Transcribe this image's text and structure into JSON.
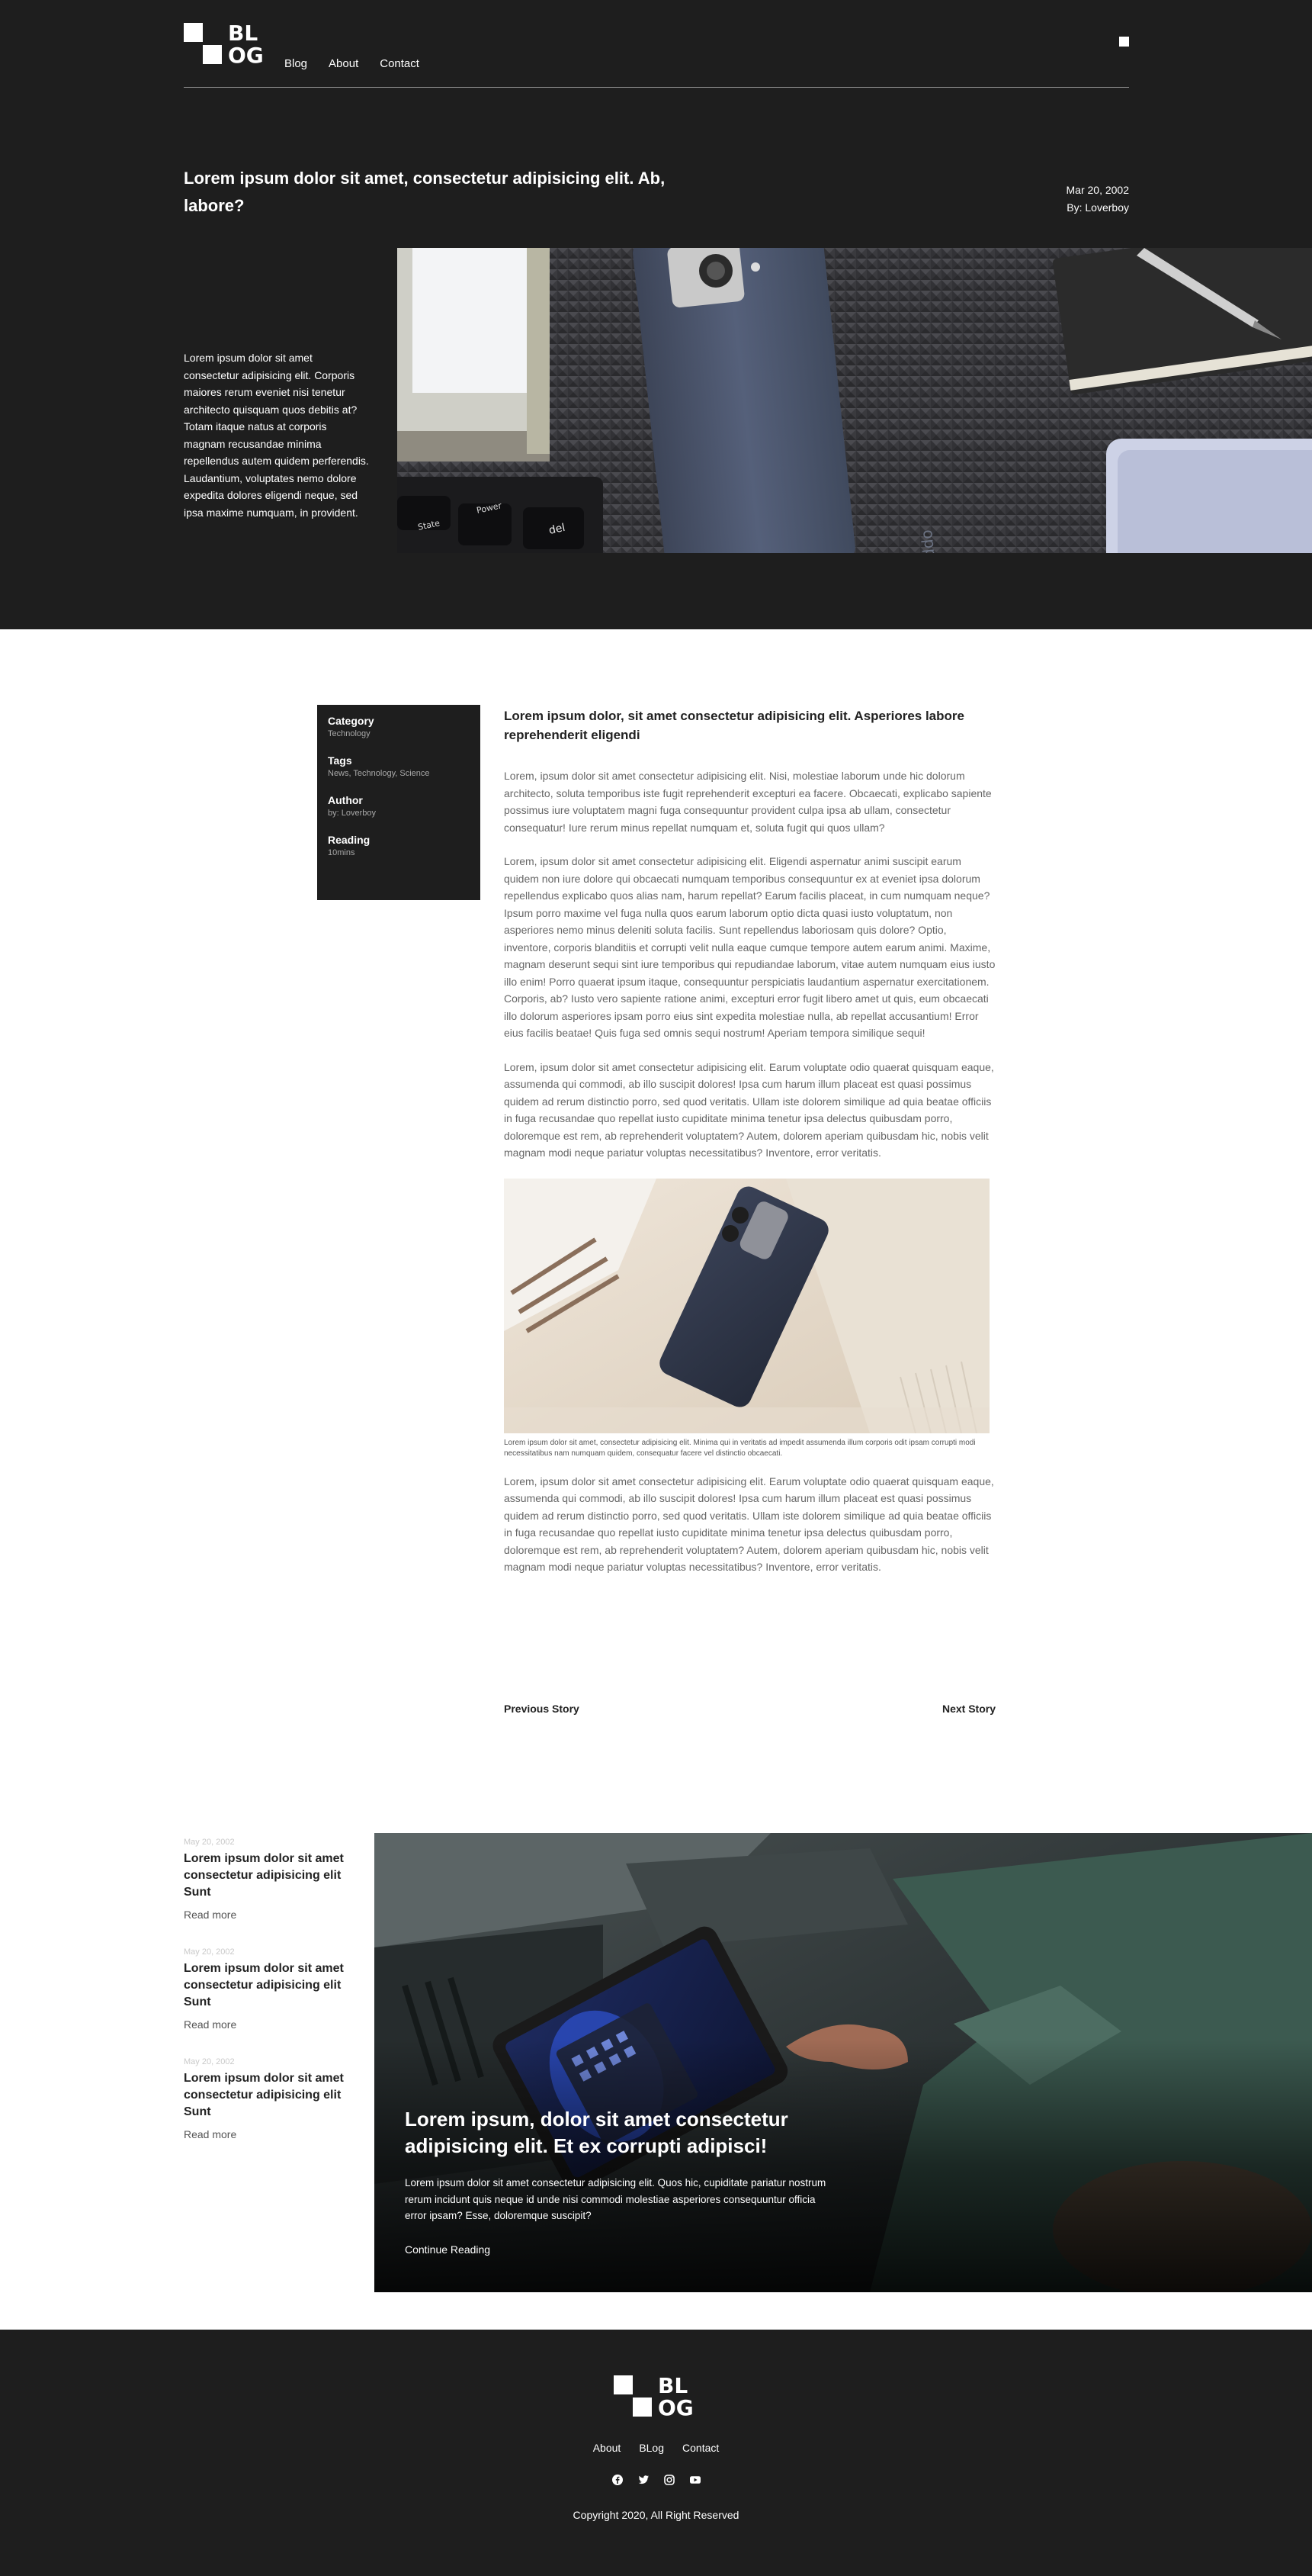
{
  "header": {
    "logo": {
      "line1": "BL",
      "line2": "OG"
    },
    "nav": [
      "Blog",
      "About",
      "Contact"
    ],
    "menu_icon": "square-menu-icon"
  },
  "hero": {
    "title": "Lorem ipsum dolor sit amet, consectetur adipisicing elit. Ab, labore?",
    "date": "Mar 20, 2002",
    "author": "By: Loverboy",
    "excerpt": "Lorem ipsum dolor sit amet consectetur adipisicing elit. Corporis maiores rerum eveniet nisi tenetur architecto quisquam quos debitis at? Totam itaque natus at corporis magnam recusandae minima repellendus autem quidem perferendis. Laudantium, voluptates nemo dolore expedita dolores eligendi neque, sed ipsa maxime numquam, in provident.",
    "image": "desk-flatlay-phone-keyboard-photo",
    "keyboard_keys": [
      "State",
      "Power",
      "del"
    ]
  },
  "sidebar": {
    "items": [
      {
        "label": "Category",
        "value": "Technology"
      },
      {
        "label": "Tags",
        "value": "News, Technology, Science"
      },
      {
        "label": "Author",
        "value": "by: Loverboy"
      },
      {
        "label": "Reading",
        "value": "10mins"
      }
    ]
  },
  "article": {
    "title": "Lorem ipsum dolor, sit amet consectetur adipisicing elit. Asperiores labore reprehenderit eligendi",
    "paragraphs": [
      "Lorem, ipsum dolor sit amet consectetur adipisicing elit. Nisi, molestiae laborum unde hic dolorum architecto, soluta temporibus iste fugit reprehenderit excepturi ea facere. Obcaecati, explicabo sapiente possimus iure voluptatem magni fuga consequuntur provident culpa ipsa ab ullam, consectetur consequatur! Iure rerum minus repellat numquam et, soluta fugit qui quos ullam?",
      "Lorem, ipsum dolor sit amet consectetur adipisicing elit. Eligendi aspernatur animi suscipit earum quidem non iure dolore qui obcaecati numquam temporibus consequuntur ex at eveniet ipsa dolorum repellendus explicabo quos alias nam, harum repellat? Earum facilis placeat, in cum numquam neque? Ipsum porro maxime vel fuga nulla quos earum laborum optio dicta quasi iusto voluptatum, non asperiores nemo minus deleniti soluta facilis. Sunt repellendus laboriosam quis dolore? Optio, inventore, corporis blanditiis et corrupti velit nulla eaque cumque tempore autem earum animi. Maxime, magnam deserunt sequi sint iure temporibus qui repudiandae laborum, vitae autem numquam eius iusto illo enim! Porro quaerat ipsum itaque, consequuntur perspiciatis laudantium aspernatur exercitationem. Corporis, ab? Iusto vero sapiente ratione animi, excepturi error fugit libero amet ut quis, eum obcaecati illo dolorum asperiores ipsam porro eius sint expedita molestiae nulla, ab repellat accusantium! Error eius facilis beatae! Quis fuga sed omnis sequi nostrum! Aperiam tempora similique sequi!",
      "Lorem, ipsum dolor sit amet consectetur adipisicing elit. Earum voluptate odio quaerat quisquam eaque, assumenda qui commodi, ab illo suscipit dolores! Ipsa cum harum illum placeat est quasi possimus quidem ad rerum distinctio porro, sed quod veritatis. Ullam iste dolorem similique ad quia beatae officiis in fuga recusandae quo repellat iusto cupiditate minima tenetur ipsa delectus quibusdam porro, doloremque est rem, ab reprehenderit voluptatem? Autem, dolorem aperiam quibusdam hic, nobis velit magnam modi neque pariatur voluptas necessitatibus? Inventore, error veritatis."
    ],
    "image": "phone-on-blanket-photo",
    "caption": "Lorem ipsum dolor sit amet, consectetur adipisicing elit. Minima qui in veritatis ad impedit assumenda illum corporis odit ipsam corrupti modi necessitatibus nam numquam quidem, consequatur facere vel distinctio obcaecati.",
    "paragraph_after": "Lorem, ipsum dolor sit amet consectetur adipisicing elit. Earum voluptate odio quaerat quisquam eaque, assumenda qui commodi, ab illo suscipit dolores! Ipsa cum harum illum placeat est quasi possimus quidem ad rerum distinctio porro, sed quod veritatis. Ullam iste dolorem similique ad quia beatae officiis in fuga recusandae quo repellat iusto cupiditate minima tenetur ipsa delectus quibusdam porro, doloremque est rem, ab reprehenderit voluptatem? Autem, dolorem aperiam quibusdam hic, nobis velit magnam modi neque pariatur voluptas necessitatibus? Inventore, error veritatis."
  },
  "story_nav": {
    "previous": "Previous Story",
    "next": "Next Story"
  },
  "related": {
    "items": [
      {
        "date": "May 20, 2002",
        "title": "Lorem ipsum dolor sit amet consectetur adipisicing elit Sunt",
        "link": "Read more"
      },
      {
        "date": "May 20, 2002",
        "title": "Lorem ipsum dolor sit amet consectetur adipisicing elit Sunt",
        "link": "Read more"
      },
      {
        "date": "May 20, 2002",
        "title": "Lorem ipsum dolor sit amet consectetur adipisicing elit Sunt",
        "link": "Read more"
      }
    ],
    "feature": {
      "title": "Lorem ipsum, dolor sit amet consectetur adipisicing elit. Et ex corrupti adipisci!",
      "text": "Lorem ipsum dolor sit amet consectetur adipisicing elit. Quos hic, cupiditate pariatur nostrum rerum incidunt quis neque id unde nisi commodi molestiae asperiores consequuntur officia error ipsam? Esse, doloremque suscipit?",
      "link": "Continue Reading",
      "image": "man-holding-tablet-in-car-photo"
    }
  },
  "footer": {
    "logo": {
      "line1": "BL",
      "line2": "OG"
    },
    "nav": [
      "About",
      "BLog",
      "Contact"
    ],
    "socials": [
      "facebook-icon",
      "twitter-icon",
      "instagram-icon",
      "youtube-icon"
    ],
    "copyright": "Copyright 2020, All Right Reserved"
  },
  "colors": {
    "dark": "#1e1e1e",
    "text": "#222222",
    "muted": "#666666",
    "white": "#ffffff"
  }
}
